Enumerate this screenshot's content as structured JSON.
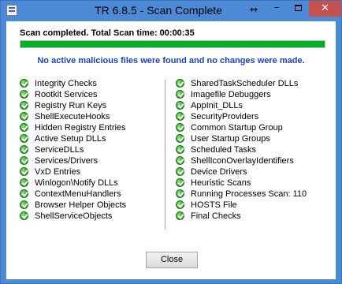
{
  "window": {
    "title": "TR 6.8.5  - Scan Complete",
    "resize_glyph": "↔",
    "minimize_glyph": "–",
    "close_glyph": "✕"
  },
  "summary": "Scan completed. Total Scan time: 00:00:35",
  "progress_fraction": 1.0,
  "progress_color": "#06b025",
  "result_message": "No active malicious files were found and no changes were made.",
  "result_color": "#1a3fd0",
  "checks_left": [
    "Integrity Checks",
    "Rootkit Services",
    "Registry Run Keys",
    "ShellExecuteHooks",
    "Hidden Registry Entries",
    "Active Setup DLLs",
    "ServiceDLLs",
    "Services/Drivers",
    "VxD Entries",
    "Winlogon\\Notify DLLs",
    "ContextMenuHandlers",
    "Browser Helper Objects",
    "ShellServiceObjects"
  ],
  "checks_right": [
    "SharedTaskScheduler DLLs",
    "Imagefile Debuggers",
    "AppInit_DLLs",
    "SecurityProviders",
    "Common Startup Group",
    "User Startup Groups",
    "Scheduled Tasks",
    "ShellIconOverlayIdentifiers",
    "Device Drivers",
    "Heuristic Scans",
    "Running Processes Scan: 110",
    "HOSTS File",
    "Final Checks"
  ],
  "check_icon": "green-check-icon",
  "close_button_label": "Close"
}
